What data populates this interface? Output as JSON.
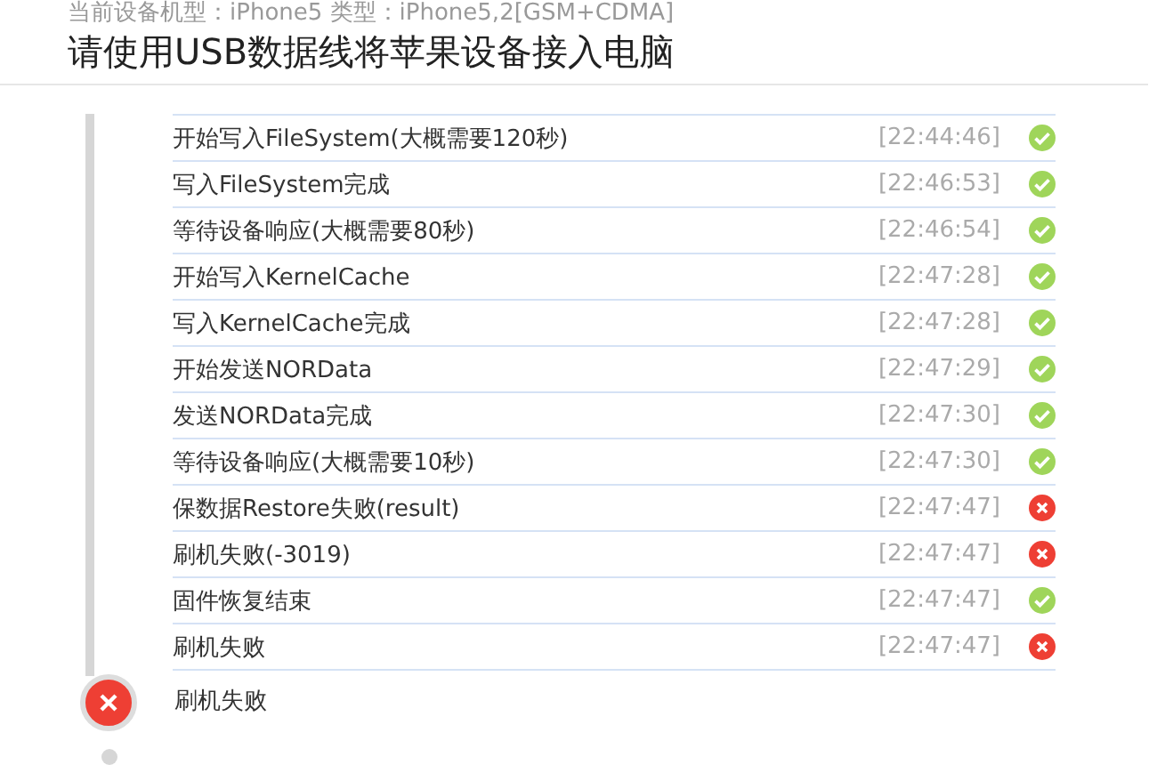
{
  "device_info": "当前设备机型：iPhone5 类型：iPhone5,2[GSM+CDMA]",
  "heading": "请使用USB数据线将苹果设备接入电脑",
  "log": [
    {
      "message": "开始写入FileSystem(大概需要120秒)",
      "time": "[22:44:46]",
      "kind": "success"
    },
    {
      "message": "写入FileSystem完成",
      "time": "[22:46:53]",
      "kind": "success"
    },
    {
      "message": "等待设备响应(大概需要80秒)",
      "time": "[22:46:54]",
      "kind": "success"
    },
    {
      "message": "开始写入KernelCache",
      "time": "[22:47:28]",
      "kind": "success"
    },
    {
      "message": "写入KernelCache完成",
      "time": "[22:47:28]",
      "kind": "success"
    },
    {
      "message": "开始发送NORData",
      "time": "[22:47:29]",
      "kind": "success"
    },
    {
      "message": "发送NORData完成",
      "time": "[22:47:30]",
      "kind": "success"
    },
    {
      "message": "等待设备响应(大概需要10秒)",
      "time": "[22:47:30]",
      "kind": "success"
    },
    {
      "message": "保数据Restore失败(result)",
      "time": "[22:47:47]",
      "kind": "fail"
    },
    {
      "message": "刷机失败(-3019)",
      "time": "[22:47:47]",
      "kind": "fail"
    },
    {
      "message": "固件恢复结束",
      "time": "[22:47:47]",
      "kind": "success"
    },
    {
      "message": "刷机失败",
      "time": "[22:47:47]",
      "kind": "fail"
    }
  ],
  "result": {
    "kind": "fail",
    "label": "刷机失败"
  }
}
